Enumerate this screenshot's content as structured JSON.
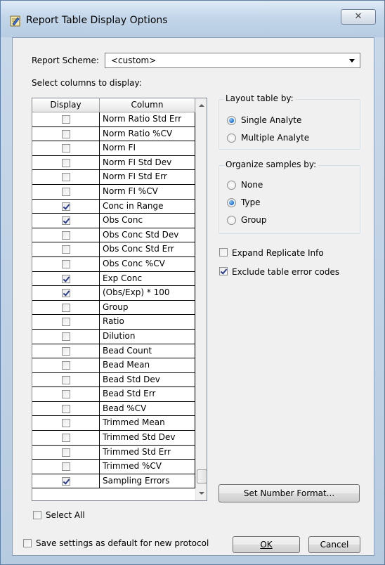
{
  "window": {
    "title": "Report Table Display Options",
    "close_glyph": "✕"
  },
  "report_scheme": {
    "label": "Report Scheme:",
    "value": "<custom>"
  },
  "select_columns_label": "Select columns to display:",
  "grid": {
    "headers": {
      "display": "Display",
      "column": "Column"
    },
    "rows": [
      {
        "name": "Norm Ratio Std Err",
        "checked": false
      },
      {
        "name": "Norm Ratio %CV",
        "checked": false
      },
      {
        "name": "Norm FI",
        "checked": false
      },
      {
        "name": "Norm FI Std Dev",
        "checked": false
      },
      {
        "name": "Norm FI Std Err",
        "checked": false
      },
      {
        "name": "Norm FI %CV",
        "checked": false
      },
      {
        "name": "Conc in Range",
        "checked": true
      },
      {
        "name": "Obs Conc",
        "checked": true
      },
      {
        "name": "Obs Conc Std Dev",
        "checked": false
      },
      {
        "name": "Obs Conc Std Err",
        "checked": false
      },
      {
        "name": "Obs Conc %CV",
        "checked": false
      },
      {
        "name": "Exp Conc",
        "checked": true
      },
      {
        "name": "(Obs/Exp) * 100",
        "checked": true
      },
      {
        "name": "Group",
        "checked": false
      },
      {
        "name": "Ratio",
        "checked": false
      },
      {
        "name": "Dilution",
        "checked": false
      },
      {
        "name": "Bead Count",
        "checked": false
      },
      {
        "name": "Bead Mean",
        "checked": false
      },
      {
        "name": "Bead Std Dev",
        "checked": false
      },
      {
        "name": "Bead Std Err",
        "checked": false
      },
      {
        "name": "Bead %CV",
        "checked": false
      },
      {
        "name": "Trimmed Mean",
        "checked": false
      },
      {
        "name": "Trimmed Std Dev",
        "checked": false
      },
      {
        "name": "Trimmed Std Err",
        "checked": false
      },
      {
        "name": "Trimmed %CV",
        "checked": false
      },
      {
        "name": "Sampling Errors",
        "checked": true
      }
    ]
  },
  "layout_group": {
    "title": "Layout table by:",
    "options": [
      {
        "label": "Single Analyte",
        "selected": true
      },
      {
        "label": "Multiple Analyte",
        "selected": false
      }
    ]
  },
  "organize_group": {
    "title": "Organize samples by:",
    "options": [
      {
        "label": "None",
        "selected": false
      },
      {
        "label": "Type",
        "selected": true
      },
      {
        "label": "Group",
        "selected": false
      }
    ]
  },
  "expand_replicate": {
    "label": "Expand Replicate Info",
    "checked": false
  },
  "exclude_errors": {
    "label": "Exclude table error codes",
    "checked": true
  },
  "set_number_format": "Set Number Format...",
  "select_all": {
    "label": "Select All",
    "checked": false
  },
  "save_default": {
    "label": "Save settings as default for new protocol",
    "checked": false
  },
  "buttons": {
    "ok": "OK",
    "cancel": "Cancel"
  }
}
